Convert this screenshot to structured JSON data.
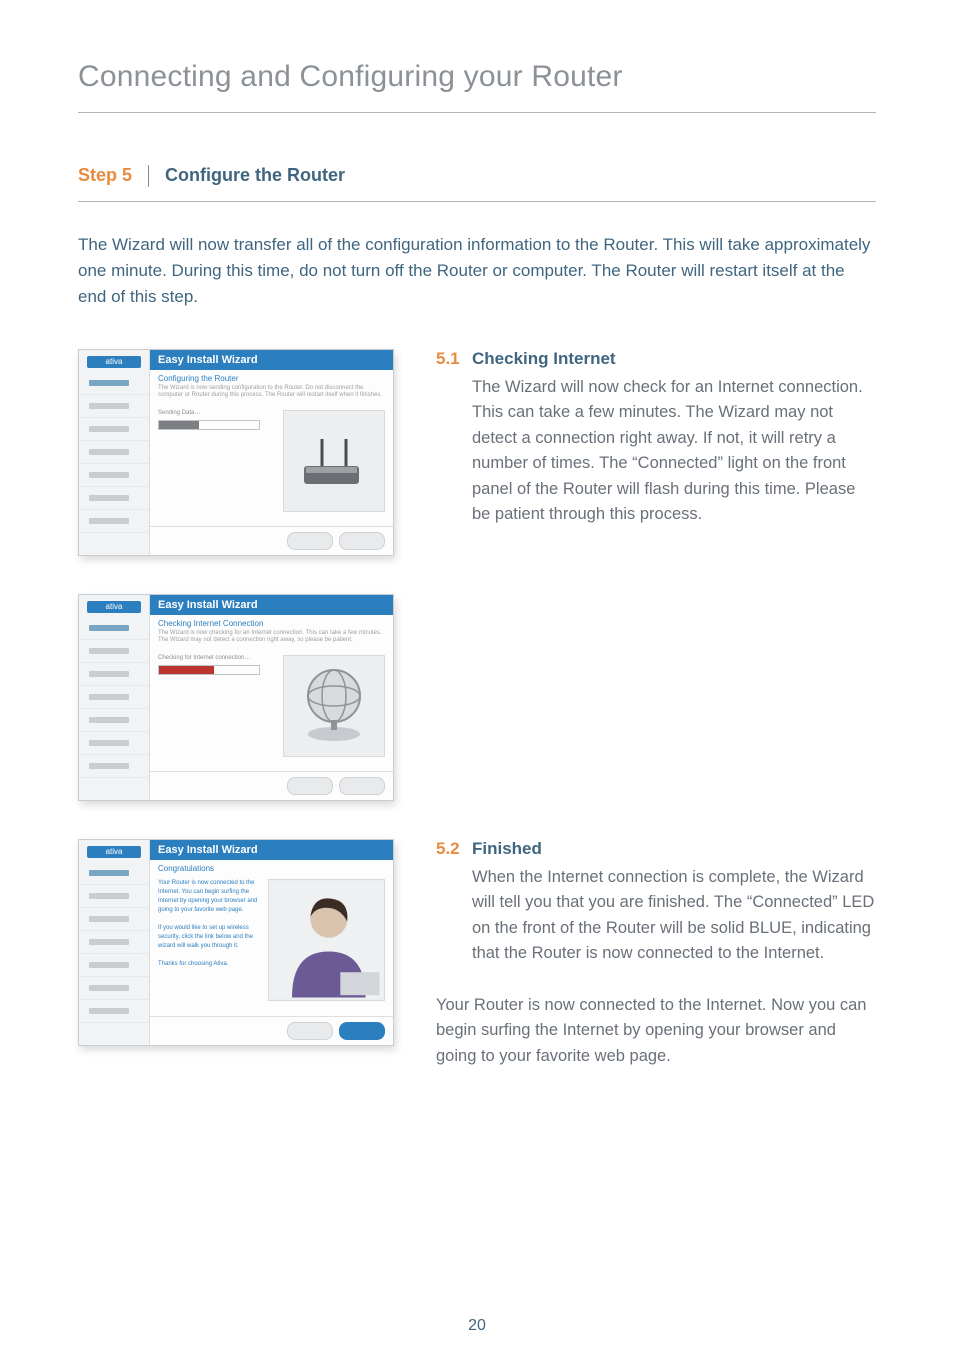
{
  "title": "Connecting and Configuring your Router",
  "step": {
    "label": "Step 5",
    "title": "Configure the Router"
  },
  "intro": "The Wizard will now transfer all of the configuration information to the Router. This will take approximately one minute. During this time, do not turn off the Router or computer. The Router will restart itself at the end of this step.",
  "sections": {
    "s51": {
      "num": "5.1",
      "title": "Checking Internet",
      "body": "The Wizard will now check for an Internet connection. This can take a few minutes. The Wizard may not detect a connection right away. If not, it will retry a number of times. The “Connected” light on the front panel of the Router will flash during this time. Please be patient through this process."
    },
    "s52": {
      "num": "5.2",
      "title": "Finished",
      "body": "When the Internet connection is complete, the Wizard will tell you that you are finished. The “Connected” LED on the front of the Router will be solid BLUE, indicating that the Router is now connected to the Internet."
    }
  },
  "closing": "Your Router is now connected to the Internet. Now you can begin surfing the Internet by opening your browser and going to your favorite web page.",
  "page_number": "20",
  "wizard": {
    "brand": "ativa",
    "header": "Easy Install Wizard",
    "sub1": "Configuring the Router",
    "sub2": "Checking Internet Connection",
    "sub3": "Congratulations"
  }
}
